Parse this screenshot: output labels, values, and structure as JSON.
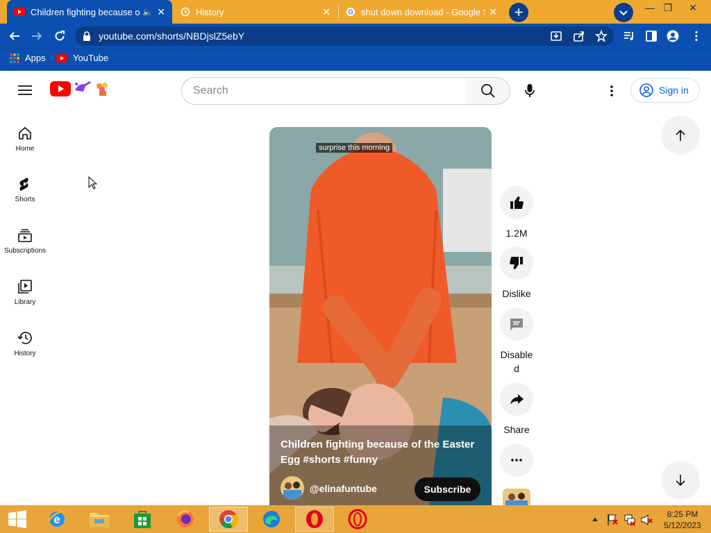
{
  "browser": {
    "tabs": [
      {
        "title": "Children fighting because of",
        "active": true
      },
      {
        "title": "History",
        "active": false
      },
      {
        "title": "shut down download - Google S",
        "active": false
      }
    ],
    "url": "youtube.com/shorts/NBDjslZ5ebY",
    "bookmarks": [
      {
        "label": "Apps"
      },
      {
        "label": "YouTube"
      }
    ]
  },
  "youtube": {
    "search_placeholder": "Search",
    "signin_label": "Sign in",
    "nav": [
      {
        "label": "Home",
        "icon": "home-icon"
      },
      {
        "label": "Shorts",
        "icon": "shorts-icon"
      },
      {
        "label": "Subscriptions",
        "icon": "subscriptions-icon"
      },
      {
        "label": "Library",
        "icon": "library-icon"
      },
      {
        "label": "History",
        "icon": "history-icon"
      }
    ],
    "short": {
      "caption_overlay": "surprise this morning",
      "title": "Children fighting because of the Easter Egg #shorts #funny",
      "channel": "@elinafuntube",
      "subscribe_label": "Subscribe"
    },
    "actions": {
      "likes": "1.2M",
      "dislike_label": "Dislike",
      "comments_label_1": "Disable",
      "comments_label_2": "d",
      "share_label": "Share"
    }
  },
  "taskbar": {
    "time": "8:25 PM",
    "date": "5/12/2023"
  },
  "colors": {
    "tab_strip": "#f0a930",
    "toolbar": "#0b4fb0",
    "youtube_red": "#ff0000",
    "signin_blue": "#065fd4",
    "taskbar": "#e8a53a"
  }
}
